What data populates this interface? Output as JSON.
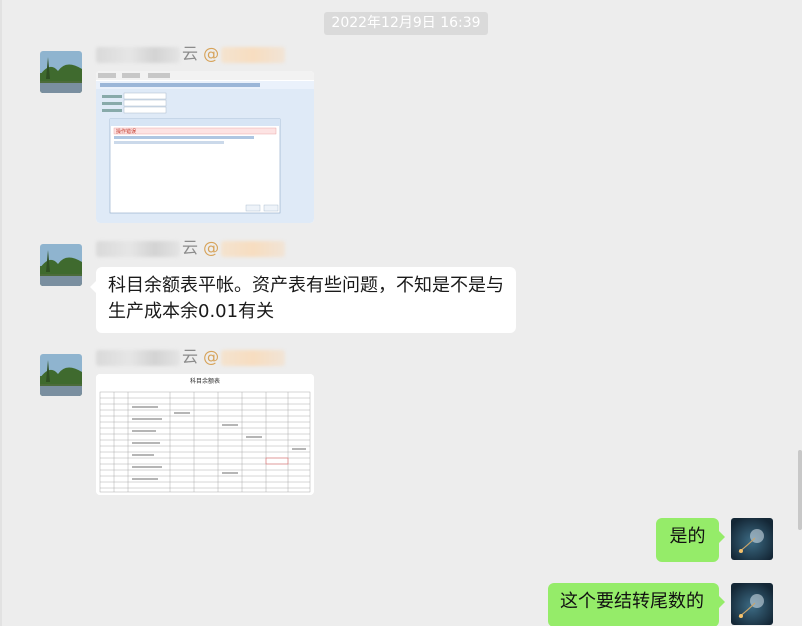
{
  "timestamp": "2022年12月9日 16:39",
  "messages": [
    {
      "sender_suffix": "云",
      "at": "@",
      "type": "image",
      "caption": "操作错误"
    },
    {
      "sender_suffix": "云",
      "at": "@",
      "type": "text",
      "text_line1": "科目余额表平帐。资产表有些问题，不知是不是与",
      "text_line2": "生产成本余0.01有关"
    },
    {
      "sender_suffix": "云",
      "at": "@",
      "type": "image",
      "caption": "科目余额表"
    },
    {
      "type": "text",
      "direction": "out",
      "text": "是的"
    },
    {
      "type": "text",
      "direction": "out",
      "text": "这个要结转尾数的"
    }
  ],
  "colors": {
    "background": "#ededed",
    "bubble_in": "#ffffff",
    "bubble_out": "#95ec69",
    "timestamp_bg": "#dadada"
  }
}
